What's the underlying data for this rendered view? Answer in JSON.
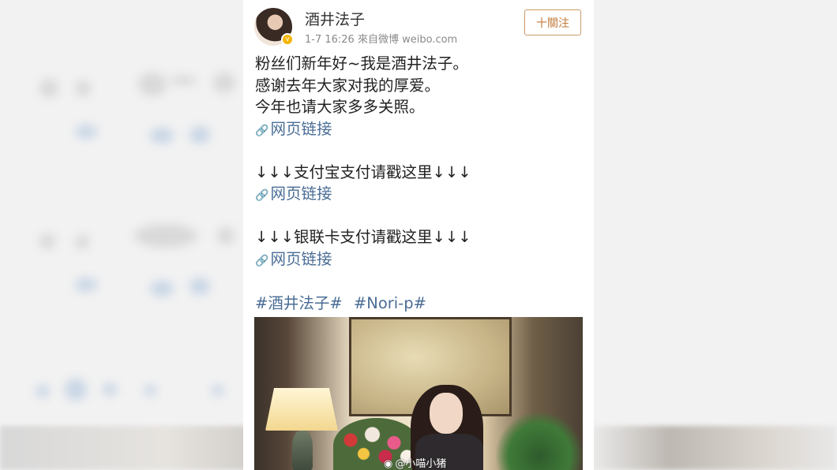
{
  "post": {
    "username": "酒井法子",
    "meta": "1-7 16:26  來自微博 weibo.com",
    "follow_label": "十關注",
    "verified_badge": "v",
    "lines": [
      "粉丝们新年好~我是酒井法子。",
      "感谢去年大家对我的厚爱。",
      "今年也请大家多多关照。",
      "网页链接",
      "↓↓↓支付宝支付请戳这里↓↓↓",
      "网页链接",
      "↓↓↓银联卡支付请戳这里↓↓↓",
      "网页链接"
    ],
    "link_icon": "🔗",
    "tags": [
      "#酒井法子#",
      "#Nori-p#"
    ],
    "watermark": "@小喵小猪",
    "watermark_icon": "weibo-logo-icon"
  },
  "colors": {
    "link": "#4a6d95",
    "follow_border": "#c99a6a",
    "verified": "#f5b400"
  }
}
